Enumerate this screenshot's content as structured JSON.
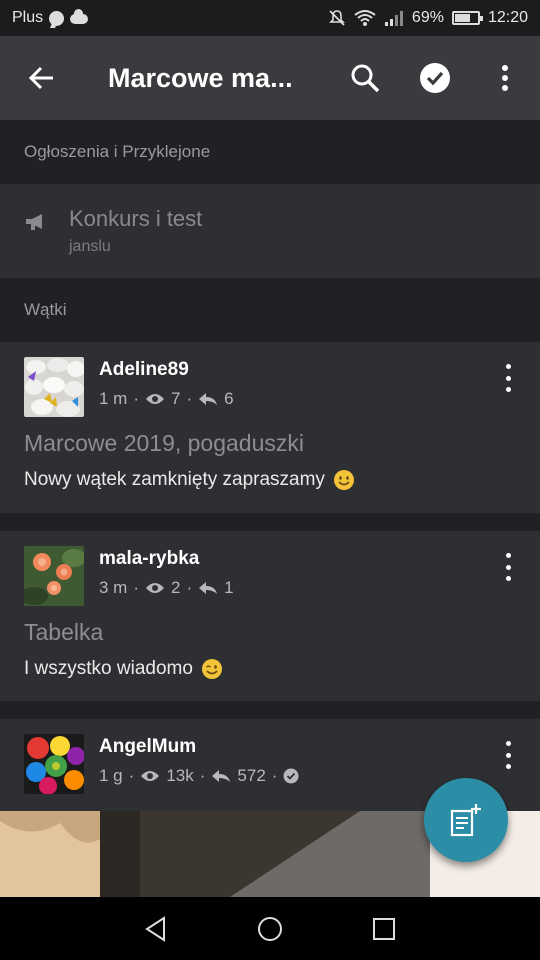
{
  "status_bar": {
    "carrier": "Plus",
    "battery": "69%",
    "battery_level": 0.69,
    "time": "12:20"
  },
  "app_bar": {
    "title": "Marcowe ma...",
    "icons": [
      "back-arrow-icon",
      "search-icon",
      "check-circle-icon",
      "more-vert-icon"
    ]
  },
  "sections": {
    "pinned_header": "Ogłoszenia i Przyklejone",
    "threads_header": "Wątki"
  },
  "pinned": {
    "title": "Konkurs i test",
    "author": "janslu",
    "icon": "megaphone-icon"
  },
  "threads": [
    {
      "user": "Adeline89",
      "time": "1 m",
      "views": "7",
      "replies": "6",
      "title": "Marcowe 2019, pogaduszki",
      "excerpt": "Nowy wątek zamknięty zapraszamy",
      "emoji": "smiling-face-icon"
    },
    {
      "user": "mala-rybka",
      "time": "3 m",
      "views": "2",
      "replies": "1",
      "title": "Tabelka",
      "excerpt": "I wszystko wiadomo",
      "emoji": "winking-face-icon"
    },
    {
      "user": "AngelMum",
      "time": "1 g",
      "views": "13k",
      "replies": "572",
      "verified_icon": "check-badge-icon"
    }
  ],
  "separator": "·",
  "colors": {
    "background": "#202124",
    "card": "#2e2f32",
    "app_bar": "#3a3b3e",
    "fab": "#2b8ea6",
    "muted_text": "#8e8e91"
  },
  "fab": {
    "icon": "new-post-icon"
  },
  "nav": {
    "icons": [
      "nav-back-icon",
      "nav-home-icon",
      "nav-recents-icon"
    ]
  }
}
